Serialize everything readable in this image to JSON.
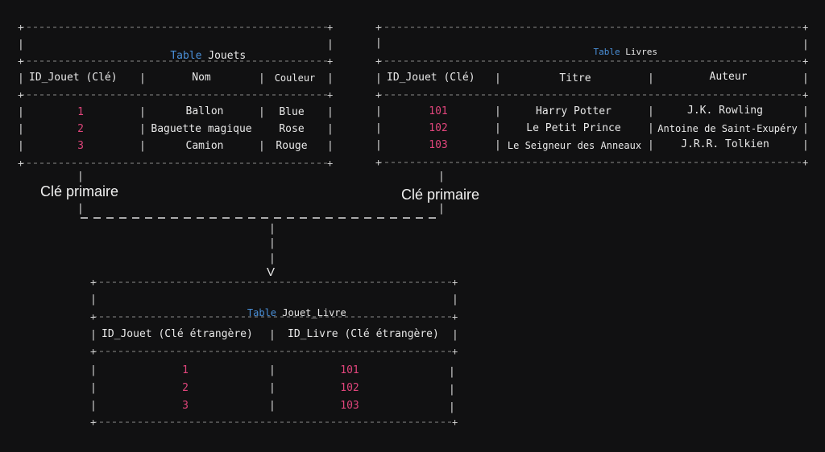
{
  "jouets": {
    "title_keyword": "Table",
    "title_name": "Jouets",
    "headers": [
      "ID_Jouet (Clé)",
      "Nom",
      "Couleur"
    ],
    "rows": [
      {
        "id": "1",
        "nom": "Ballon",
        "couleur": "Blue"
      },
      {
        "id": "2",
        "nom": "Baguette magique",
        "couleur": "Rose"
      },
      {
        "id": "3",
        "nom": "Camion",
        "couleur": "Rouge"
      }
    ]
  },
  "livres": {
    "title_keyword": "Table",
    "title_name": "Livres",
    "headers": [
      "ID_Jouet (Clé)",
      "Titre",
      "Auteur"
    ],
    "rows": [
      {
        "id": "101",
        "titre": "Harry Potter",
        "auteur": "J.K. Rowling"
      },
      {
        "id": "102",
        "titre": "Le Petit Prince",
        "auteur": "Antoine de Saint-Exupéry"
      },
      {
        "id": "103",
        "titre": "Le Seigneur des Anneaux",
        "auteur": "J.R.R. Tolkien"
      }
    ]
  },
  "jouet_livre": {
    "title_keyword": "Table",
    "title_name": "Jouet_Livre",
    "headers": [
      "ID_Jouet (Clé étrangère)",
      "ID_Livre (Clé étrangère)"
    ],
    "rows": [
      {
        "jouet": "1",
        "livre": "101"
      },
      {
        "jouet": "2",
        "livre": "102"
      },
      {
        "jouet": "3",
        "livre": "103"
      }
    ]
  },
  "connector": {
    "left_label": "Clé primaire",
    "right_label": "Clé primaire",
    "arrow_head": "V"
  },
  "colors": {
    "background": "#111112",
    "keyword": "#4a90d9",
    "number": "#e0457b",
    "text": "#e8e8e8"
  }
}
